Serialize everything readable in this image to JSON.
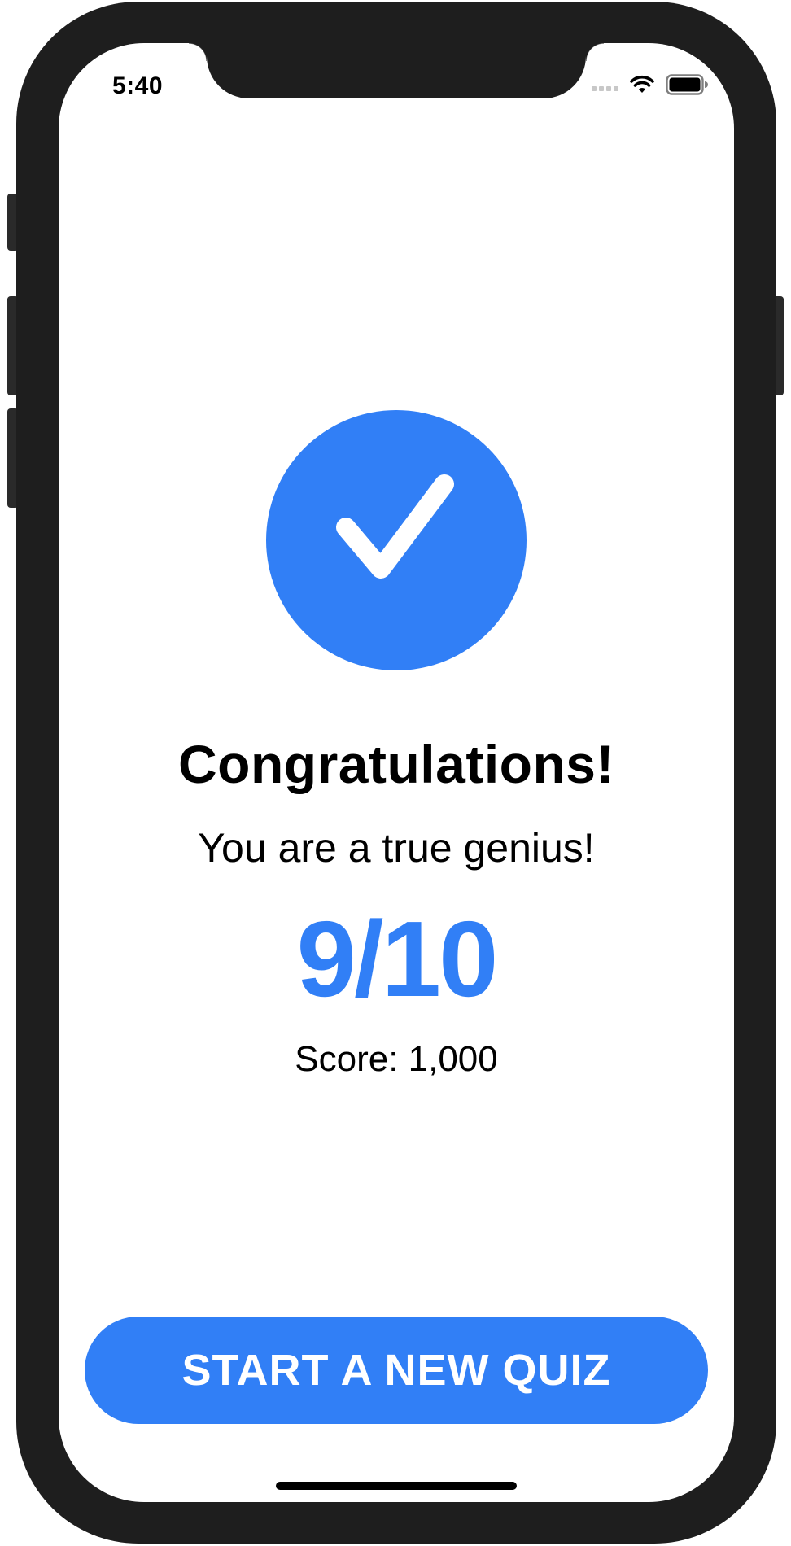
{
  "status_bar": {
    "time": "5:40"
  },
  "result": {
    "icon": "checkmark-circle",
    "title": "Congratulations!",
    "subtitle": "You are a true genius!",
    "score_fraction": "9/10",
    "correct": 9,
    "total": 10,
    "score_text": "Score: 1,000"
  },
  "actions": {
    "start_new_quiz_label": "START A NEW QUIZ"
  },
  "colors": {
    "accent": "#317ff6",
    "frame": "#1e1e1e",
    "background": "#ffffff",
    "text": "#000000"
  }
}
